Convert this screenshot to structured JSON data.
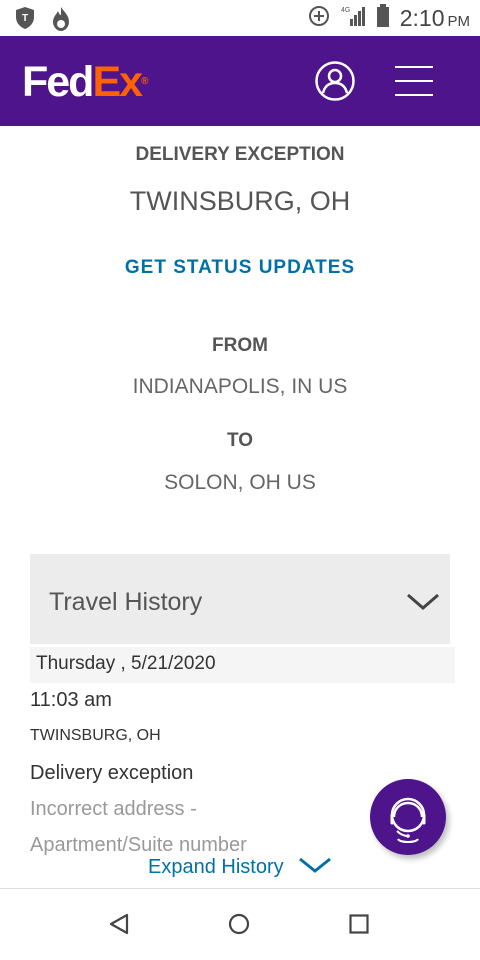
{
  "status_bar": {
    "time": "2:10",
    "ampm": "PM",
    "network": "4G LTE"
  },
  "header": {
    "logo_fed": "Fed",
    "logo_ex": "Ex",
    "logo_reg": "®",
    "account_icon": "account-icon",
    "menu_icon": "hamburger-menu-icon"
  },
  "shipment": {
    "status": "DELIVERY EXCEPTION",
    "location": "TWINSBURG, OH",
    "updates_link": "GET STATUS UPDATES",
    "from_label": "FROM",
    "from_value": "INDIANAPOLIS, IN US",
    "to_label": "TO",
    "to_value": "SOLON, OH US"
  },
  "travel_history": {
    "title": "Travel History",
    "date": "Thursday , 5/21/2020",
    "event": {
      "time": "11:03 am",
      "location": "TWINSBURG, OH",
      "status": "Delivery exception",
      "detail_line1": "Incorrect address -",
      "detail_line2": "Apartment/Suite number"
    },
    "expand_label": "Expand History"
  },
  "colors": {
    "brand_purple": "#4d148c",
    "brand_orange": "#ff6200",
    "link_blue": "#0071a8"
  }
}
